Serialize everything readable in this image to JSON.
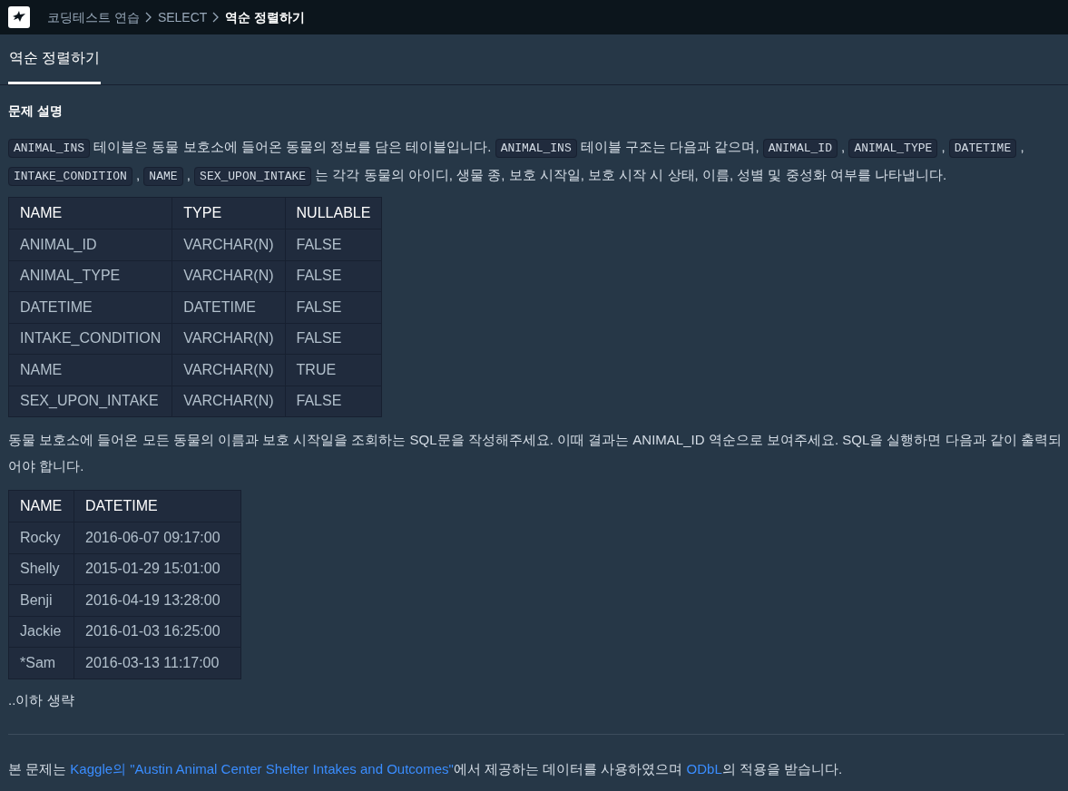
{
  "breadcrumb": [
    "코딩테스트 연습",
    "SELECT",
    "역순 정렬하기"
  ],
  "tabs": [
    {
      "label": "역순 정렬하기",
      "selected": true
    }
  ],
  "section_title": "문제 설명",
  "description": [
    {
      "kind": "code",
      "text": "ANIMAL_INS"
    },
    {
      "kind": "text",
      "text": " 테이블은 동물 보호소에 들어온 동물의 정보를 담은 테이블입니다. "
    },
    {
      "kind": "code",
      "text": "ANIMAL_INS"
    },
    {
      "kind": "text",
      "text": " 테이블 구조는 다음과 같으며, "
    },
    {
      "kind": "code",
      "text": "ANIMAL_ID"
    },
    {
      "kind": "text",
      "text": " , "
    },
    {
      "kind": "code",
      "text": "ANIMAL_TYPE"
    },
    {
      "kind": "text",
      "text": " , "
    },
    {
      "kind": "code",
      "text": "DATETIME"
    },
    {
      "kind": "text",
      "text": " , "
    },
    {
      "kind": "code",
      "text": "INTAKE_CONDITION"
    },
    {
      "kind": "text",
      "text": " , "
    },
    {
      "kind": "code",
      "text": "NAME"
    },
    {
      "kind": "text",
      "text": " , "
    },
    {
      "kind": "code",
      "text": "SEX_UPON_INTAKE"
    },
    {
      "kind": "text",
      "text": " 는 각각 동물의 아이디, 생물 종, 보호 시작일, 보호 시작 시 상태, 이름, 성별 및 중성화 여부를 나타냅니다."
    }
  ],
  "schema_table": {
    "columns": [
      "NAME",
      "TYPE",
      "NULLABLE"
    ],
    "rows": [
      [
        "ANIMAL_ID",
        "VARCHAR(N)",
        "FALSE"
      ],
      [
        "ANIMAL_TYPE",
        "VARCHAR(N)",
        "FALSE"
      ],
      [
        "DATETIME",
        "DATETIME",
        "FALSE"
      ],
      [
        "INTAKE_CONDITION",
        "VARCHAR(N)",
        "FALSE"
      ],
      [
        "NAME",
        "VARCHAR(N)",
        "TRUE"
      ],
      [
        "SEX_UPON_INTAKE",
        "VARCHAR(N)",
        "FALSE"
      ]
    ]
  },
  "question": "동물 보호소에 들어온 모든 동물의 이름과 보호 시작일을 조회하는 SQL문을 작성해주세요. 이때 결과는 ANIMAL_ID 역순으로 보여주세요. SQL을 실행하면 다음과 같이 출력되어야 합니다.",
  "result_table": {
    "columns": [
      "NAME",
      "DATETIME"
    ],
    "rows": [
      [
        "Rocky",
        "2016-06-07 09:17:00"
      ],
      [
        "Shelly",
        "2015-01-29 15:01:00"
      ],
      [
        "Benji",
        "2016-04-19 13:28:00"
      ],
      [
        "Jackie",
        "2016-01-03 16:25:00"
      ],
      [
        "*Sam",
        "2016-03-13 11:17:00"
      ]
    ]
  },
  "ellipsis_note": "..이하 생략",
  "footer": [
    {
      "kind": "text",
      "text": "본 문제는 "
    },
    {
      "kind": "link",
      "text": "Kaggle의 \"Austin Animal Center Shelter Intakes and Outcomes\""
    },
    {
      "kind": "text",
      "text": "에서 제공하는 데이터를 사용하였으며 "
    },
    {
      "kind": "link",
      "text": "ODbL"
    },
    {
      "kind": "text",
      "text": "의 적용을 받습니다."
    }
  ]
}
